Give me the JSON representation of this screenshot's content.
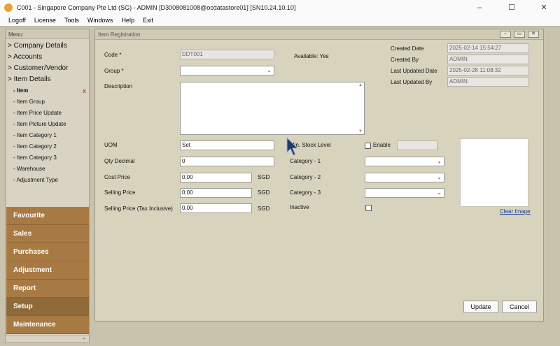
{
  "window": {
    "title": "C001 - Singapore Company Pte Ltd (SG) - ADMIN [D3008081008@ocdatastore01] [SN10.24.10.10]",
    "controls": [
      "–",
      "☐",
      "✕"
    ]
  },
  "menubar": [
    "Logoff",
    "License",
    "Tools",
    "Windows",
    "Help",
    "Exit"
  ],
  "menu_panel": {
    "header": "Menu",
    "tree": [
      {
        "label": "> Company Details",
        "level": 0
      },
      {
        "label": "> Accounts",
        "level": 0
      },
      {
        "label": "> Customer/Vendor",
        "level": 0
      },
      {
        "label": "> Item Details",
        "level": 0
      },
      {
        "label": "- Item",
        "level": 1,
        "active": true
      },
      {
        "label": "- Item Group",
        "level": 1
      },
      {
        "label": "- Item Price Update",
        "level": 1
      },
      {
        "label": "- Item Picture Update",
        "level": 1
      },
      {
        "label": "- Item Category 1",
        "level": 1
      },
      {
        "label": "- Item Category 2",
        "level": 1
      },
      {
        "label": "- Item Category 3",
        "level": 1
      },
      {
        "label": "- Warehouse",
        "level": 1
      },
      {
        "label": "- Adjustment Type",
        "level": 1
      }
    ],
    "active_close": "x",
    "sections": [
      "Favourite",
      "Sales",
      "Purchases",
      "Adjustment",
      "Report",
      "Setup",
      "Maintenance"
    ],
    "active_section": "Setup"
  },
  "item_registration": {
    "title": "Item Registration",
    "code_label": "Code *",
    "code_value": "DDT001",
    "available_label": "Available: Yes",
    "group_label": "Group *",
    "group_value": "",
    "description_label": "Description",
    "description_value": "",
    "uom_label": "UOM",
    "uom_value": "Set",
    "qty_decimal_label": "Qty Decimal",
    "qty_decimal_value": "0",
    "cost_price_label": "Cost Price",
    "cost_price_value": "0.00",
    "selling_price_label": "Selling Price",
    "selling_price_value": "0.00",
    "selling_price_tax_label": "Selling Price (Tax Inclusive)",
    "selling_price_tax_value": "0.00",
    "currency": "SGD",
    "min_stock_label": "Min. Stock Level",
    "enable_label": "Enable",
    "enable_checked": false,
    "min_stock_value": "",
    "category1_label": "Category - 1",
    "category2_label": "Category - 2",
    "category3_label": "Category - 3",
    "inactive_label": "Inactive",
    "inactive_checked": false,
    "created_date_label": "Created Date",
    "created_date_value": "2025-02-14 15:54:27",
    "created_by_label": "Created By",
    "created_by_value": "ADMIN",
    "last_updated_date_label": "Last Updated Date",
    "last_updated_date_value": "2025-02-28 11:08:32",
    "last_updated_by_label": "Last Updated By",
    "last_updated_by_value": "ADMIN",
    "clear_image_label": "Clear Image",
    "update_button": "Update",
    "cancel_button": "Cancel"
  },
  "colors": {
    "background": "#c9c2ad",
    "panel": "#d8d3c3",
    "section": "#a87a43",
    "section_active": "#8e6a3a",
    "form": "#d8d3bd",
    "link": "#1a3fa0",
    "close_mark": "#c44a00"
  }
}
